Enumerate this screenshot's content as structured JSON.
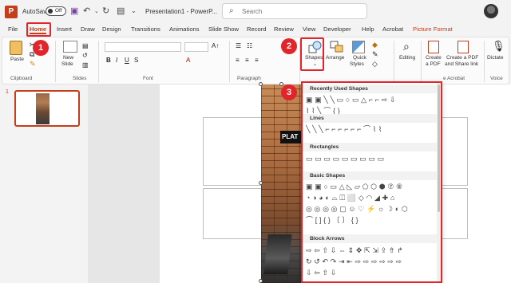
{
  "titlebar": {
    "app_logo": "P",
    "autosave_label": "AutoSave",
    "autosave_state": "Off",
    "doc_title": "Presentation1 - PowerP...",
    "search_placeholder": "Search",
    "icons": [
      "save-icon",
      "undo-icon",
      "redo-icon",
      "present-icon",
      "customize-icon"
    ]
  },
  "tabs": [
    "File",
    "Home",
    "Insert",
    "Draw",
    "Design",
    "Transitions",
    "Animations",
    "Slide Show",
    "Record",
    "Review",
    "View",
    "Developer",
    "Help",
    "Acrobat",
    "Picture Format"
  ],
  "active_tab": "Home",
  "ribbon": {
    "paste_label": "Paste",
    "new_slide_label": [
      "New",
      "Slide"
    ],
    "shapes_label": "Shapes",
    "arrange_label": "Arrange",
    "quick_styles_label": [
      "Quick",
      "Styles"
    ],
    "editing_label": "Editing",
    "create_pdf_label": [
      "Create",
      "a PDF"
    ],
    "create_share_label": [
      "Create a PDF",
      "and Share link"
    ],
    "dictate_label": "Dictate",
    "groups": {
      "clipboard": "Clipboard",
      "slides": "Slides",
      "font": "Font",
      "paragraph": "Paragraph",
      "acrobat": "e Acrobat",
      "voice": "Voice"
    }
  },
  "slides": {
    "numbers": [
      "1"
    ]
  },
  "photo": {
    "sign_text": "PLAT"
  },
  "shapes_menu": {
    "sections": [
      {
        "title": "Recently Used Shapes",
        "rows": [
          "▣▣╲╲▭○▭△⌐⌐⇨⇩",
          "⌇⌇╲⌒{}"
        ]
      },
      {
        "title": "Lines",
        "rows": [
          "╲╲╲⌐⌐⌐⌐⌐⌐⌒⌇⌇"
        ]
      },
      {
        "title": "Rectangles",
        "rows": [
          "▭▭▭▭▭▭▭▭▭"
        ]
      },
      {
        "title": "Basic Shapes",
        "rows": [
          "▣▣○▭△◺▱⬠⬡⬢⑦⑧",
          "◔◑◕◐⌓◫⬜◇◠◢✚⌂",
          "◎◎◎◎▢☺♡⚡☼☽◐⬡",
          "⌒[]{}〔〕{}"
        ]
      },
      {
        "title": "Block Arrows",
        "rows": [
          "⇨⇦⇧⇩⇔⇕✥⇱⇲⇪⇮↱",
          "↻↺↶↷⇥⇤⇨⇨⇨⇨⇨⇨",
          "⇩⇦⇧⇩"
        ]
      }
    ]
  },
  "callouts": [
    "1",
    "2",
    "3"
  ],
  "colors": {
    "accent": "#c43e1c",
    "highlight": "#e0252b"
  }
}
